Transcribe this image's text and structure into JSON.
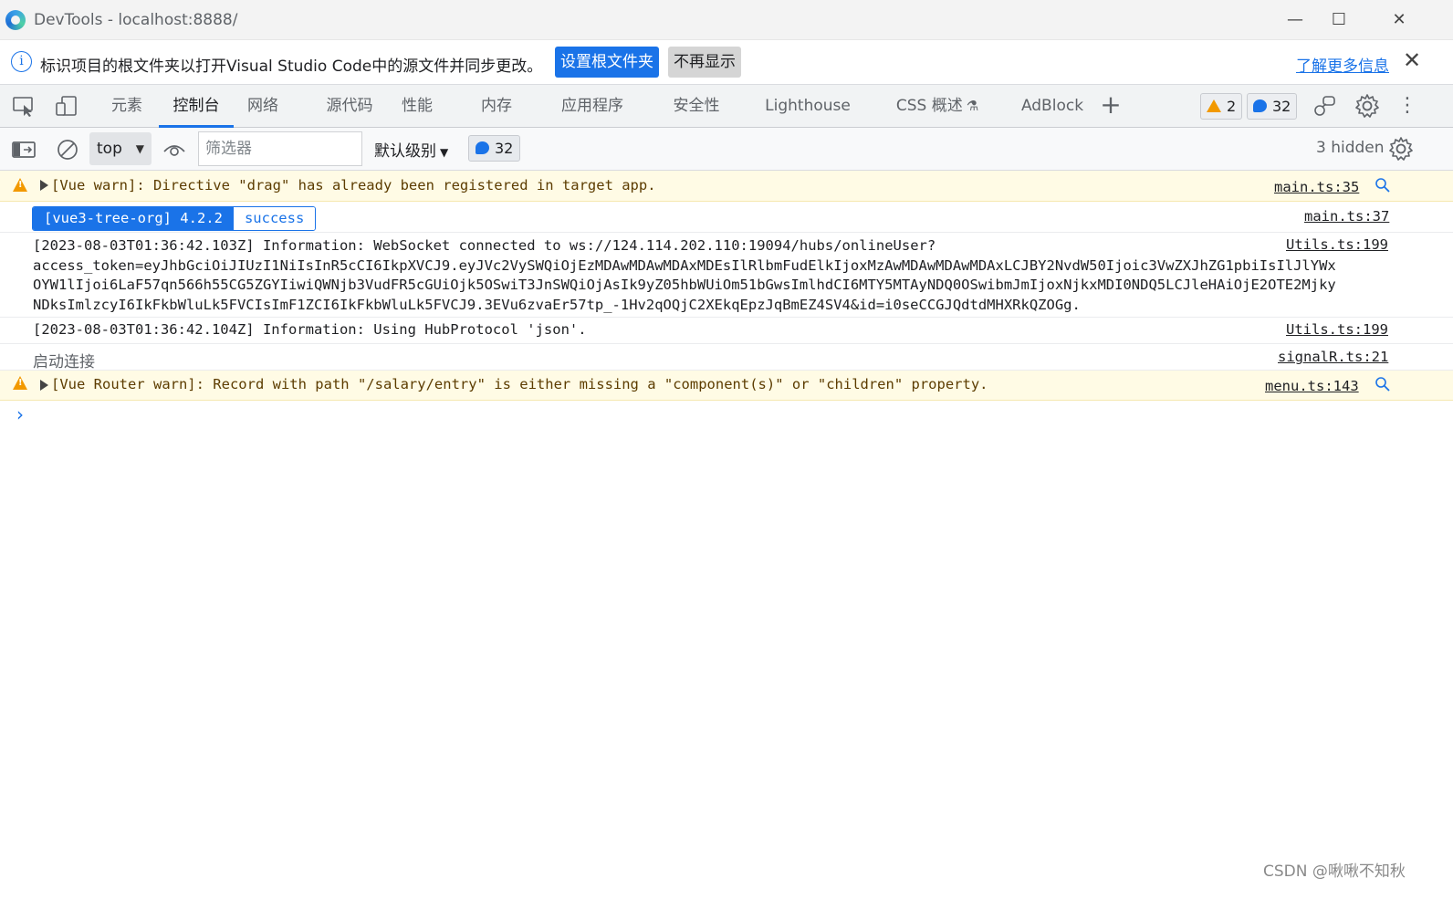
{
  "window": {
    "title": "DevTools - localhost:8888/",
    "minimize": "—",
    "maximize": "☐",
    "close": "✕"
  },
  "infobar": {
    "icon": "i",
    "message": "标识项目的根文件夹以打开Visual Studio Code中的源文件并同步更改。",
    "primary_button": "设置根文件夹",
    "secondary_button": "不再显示",
    "learn_more": "了解更多信息",
    "close": "✕"
  },
  "tabs": {
    "items": [
      {
        "label": "元素"
      },
      {
        "label": "控制台"
      },
      {
        "label": "网络"
      },
      {
        "label": "源代码"
      },
      {
        "label": "性能"
      },
      {
        "label": "内存"
      },
      {
        "label": "应用程序"
      },
      {
        "label": "安全性"
      },
      {
        "label": "Lighthouse"
      },
      {
        "label": "CSS 概述"
      },
      {
        "label": "AdBlock"
      }
    ],
    "active_index": 1,
    "plus": "+",
    "warning_count": "2",
    "message_count": "32",
    "more": "⋮"
  },
  "console_toolbar": {
    "context": "top",
    "filter_placeholder": "筛选器",
    "level": "默认级别",
    "message_count": "32",
    "hidden": "3 hidden"
  },
  "messages": [
    {
      "type": "warning",
      "text": "[Vue warn]: Directive \"drag\" has already been registered in target app.",
      "source": "main.ts:35"
    },
    {
      "type": "badge",
      "badge_left": "[vue3-tree-org] 4.2.2",
      "badge_right": "success",
      "source": "main.ts:37"
    },
    {
      "type": "info",
      "line1_prefix": "[2023-08-03T01:36:42.103Z] Information: WebSocket connected to ws:",
      "line1_link": "//124.114.202.110:19094",
      "line1_suffix": "/hubs/onlineUser?",
      "line2": "access_token=eyJhbGciOiJIUzI1NiIsInR5cCI6IkpXVCJ9.eyJVc2VySWQiOjEzMDAwMDAwMDAxMDEsIlRlbmFudElkIjoxMzAwMDAwMDAwMDAxLCJBY2NvdW50Ijoic3VwZXJhZG1pbiIsIlJlYWx",
      "line3": "OYW1lIjoi6LaF57qn566h55CG5ZGYIiwiQWNjb3VudFR5cGUiOjk5OSwiT3JnSWQiOjAsIk9yZ05hbWUiOm51bGwsImlhdCI6MTY5MTAyNDQ0OSwibmJmIjoxNjkxMDI0NDQ5LCJleHAiOjE2OTE2Mjky",
      "line4": "NDksImlzcyI6IkFkbWluLk5FVCIsImF1ZCI6IkFkbWluLk5FVCJ9.3EVu6zvaEr57tp_-1Hv2qOQjC2XEkqEpzJqBmEZ4SV4&id=i0seCCGJQdtdMHXRkQZOGg.",
      "source": "Utils.ts:199"
    },
    {
      "type": "info",
      "text": "[2023-08-03T01:36:42.104Z] Information: Using HubProtocol 'json'.",
      "source": "Utils.ts:199"
    },
    {
      "type": "log",
      "text": "启动连接",
      "source": "signalR.ts:21"
    },
    {
      "type": "warning",
      "text": "[Vue Router warn]: Record with path \"/salary/entry\" is either missing a \"component(s)\" or \"children\" property.",
      "source": "menu.ts:143"
    }
  ],
  "prompt": "›",
  "watermark": "CSDN @啾啾不知秋",
  "colors": {
    "accent": "#1a73e8",
    "warning": "#f29900",
    "warning_bg": "#fffbe5"
  }
}
